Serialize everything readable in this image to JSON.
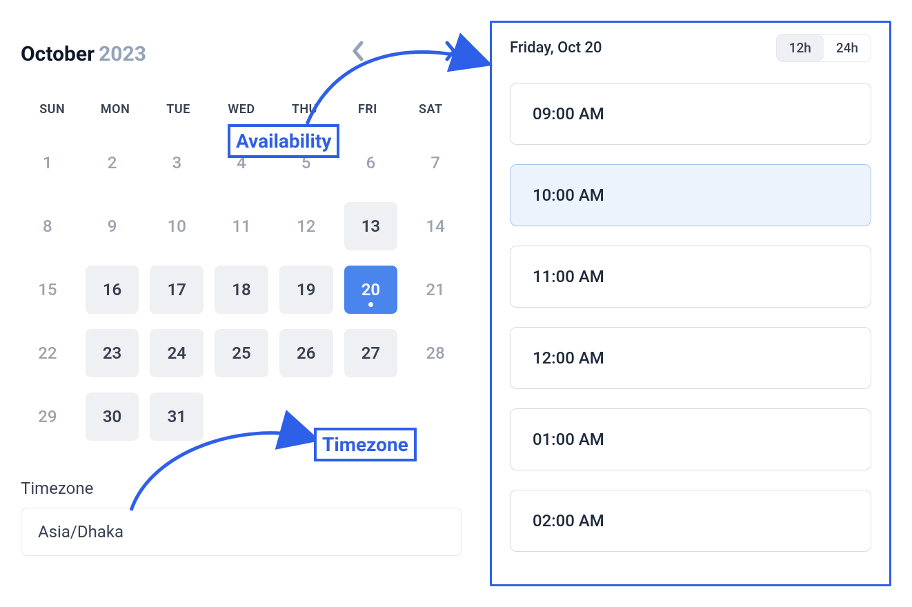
{
  "calendar": {
    "month": "October",
    "year": "2023",
    "weekdays": [
      "SUN",
      "MON",
      "TUE",
      "WED",
      "THU",
      "FRI",
      "SAT"
    ],
    "days": [
      {
        "n": "1",
        "state": "muted"
      },
      {
        "n": "2",
        "state": "muted"
      },
      {
        "n": "3",
        "state": "muted"
      },
      {
        "n": "4",
        "state": "muted"
      },
      {
        "n": "5",
        "state": "muted"
      },
      {
        "n": "6",
        "state": "muted"
      },
      {
        "n": "7",
        "state": "muted"
      },
      {
        "n": "8",
        "state": "muted"
      },
      {
        "n": "9",
        "state": "muted"
      },
      {
        "n": "10",
        "state": "muted"
      },
      {
        "n": "11",
        "state": "muted"
      },
      {
        "n": "12",
        "state": "muted"
      },
      {
        "n": "13",
        "state": "available"
      },
      {
        "n": "14",
        "state": "muted"
      },
      {
        "n": "15",
        "state": "muted"
      },
      {
        "n": "16",
        "state": "available"
      },
      {
        "n": "17",
        "state": "available"
      },
      {
        "n": "18",
        "state": "available"
      },
      {
        "n": "19",
        "state": "available"
      },
      {
        "n": "20",
        "state": "selected"
      },
      {
        "n": "21",
        "state": "muted"
      },
      {
        "n": "22",
        "state": "muted"
      },
      {
        "n": "23",
        "state": "available"
      },
      {
        "n": "24",
        "state": "available"
      },
      {
        "n": "25",
        "state": "available"
      },
      {
        "n": "26",
        "state": "available"
      },
      {
        "n": "27",
        "state": "available"
      },
      {
        "n": "28",
        "state": "muted"
      },
      {
        "n": "29",
        "state": "muted"
      },
      {
        "n": "30",
        "state": "available"
      },
      {
        "n": "31",
        "state": "available"
      }
    ]
  },
  "timezone": {
    "label": "Timezone",
    "value": "Asia/Dhaka"
  },
  "times": {
    "date_label": "Friday, Oct 20",
    "format": {
      "h12": "12h",
      "h24": "24h",
      "active": "12h"
    },
    "slots": [
      {
        "label": "09:00 AM",
        "selected": false
      },
      {
        "label": "10:00 AM",
        "selected": true
      },
      {
        "label": "11:00 AM",
        "selected": false
      },
      {
        "label": "12:00 AM",
        "selected": false
      },
      {
        "label": "01:00 AM",
        "selected": false
      },
      {
        "label": "02:00 AM",
        "selected": false
      }
    ]
  },
  "annotations": {
    "availability": "Availability",
    "timezone": "Timezone"
  }
}
